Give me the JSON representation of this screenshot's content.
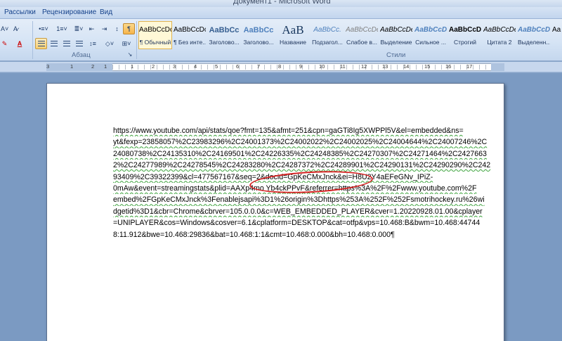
{
  "window": {
    "title": "Документ1 - Microsoft Word"
  },
  "tabs": [
    {
      "label": "Рассылки"
    },
    {
      "label": "Рецензирование"
    },
    {
      "label": "Вид"
    }
  ],
  "groups": {
    "paragraph_label": "Абзац",
    "styles_label": "Стили"
  },
  "styles": [
    {
      "sample": "AaBbCcDc",
      "name": "¶ Обычный",
      "active": true
    },
    {
      "sample": "AaBbCcDc",
      "name": "¶ Без инте..."
    },
    {
      "sample": "AaBbCc",
      "name": "Заголово..."
    },
    {
      "sample": "AaBbCc",
      "name": "Заголово..."
    },
    {
      "sample": "AaB",
      "name": "Название"
    },
    {
      "sample": "AaBbCc.",
      "name": "Подзагол..."
    },
    {
      "sample": "AaBbCcDe",
      "name": "Слабое в..."
    },
    {
      "sample": "AaBbCcDe",
      "name": "Выделение"
    },
    {
      "sample": "AaBbCcDe",
      "name": "Сильное ..."
    },
    {
      "sample": "AaBbCcDe",
      "name": "Строгий"
    },
    {
      "sample": "AaBbCcDe",
      "name": "Цитата 2"
    },
    {
      "sample": "AaBbCcDe",
      "name": "Выделенн..."
    },
    {
      "sample": "AaBbC",
      "name": ""
    }
  ],
  "ruler": {
    "numbers": [
      "3",
      "1",
      "2",
      "1",
      "1",
      "2",
      "3",
      "4",
      "5",
      "6",
      "7",
      "8",
      "9",
      "10",
      "11",
      "12",
      "13",
      "14",
      "15",
      "16",
      "17"
    ]
  },
  "document": {
    "lines": [
      "https://www.youtube.com/api/stats/qoe?fmt=135&afmt=251&cpn=gaGTi8Ig5XWPPl5V&el=embedded&ns=",
      "yt&fexp=23858057%2C23983296%2C24001373%2C24002022%2C24002025%2C24004644%2C24007246%2C",
      "24080738%2C24135310%2C24169501%2C24226335%2C24248385%2C24270307%2C24271464%2C2427663",
      "2%2C24277989%2C24278545%2C24283280%2C24287372%2C24289901%2C24290131%2C24290290%2C242",
      "93409%2C39322399&cl=477567167&seq=2&docid=GpKeCMxJnck&ei=H8U2Y4aEFeGNv_IPiZ-",
      "0mAw&event=streamingstats&plid=AAXp4mo Yb4ckPPvF&referrer=https%3A%2F%2Fwww.youtube.com%2F",
      "embed%2FGpKeCMxJnck%3Fenablejsapi%3D1%26origin%3Dhttps%253A%252F%252Fsmotrihockey.ru%26wi",
      "dgetid%3D1&cbr=Chrome&cbrver=105.0.0.0&c=WEB_EMBEDDED_PLAYER&cver=1.20220928.01.00&cplayer",
      "=UNIPLAYER&cos=Windows&cosver=6.1&cplatform=DESKTOP&cat=otfp&vps=10.468:B&bwm=10.468:44744",
      "8:11.912&bwe=10.468:29836&bat=10.468:1:1&cmt=10.468:0.000&bh=10.468:0.000¶"
    ]
  }
}
